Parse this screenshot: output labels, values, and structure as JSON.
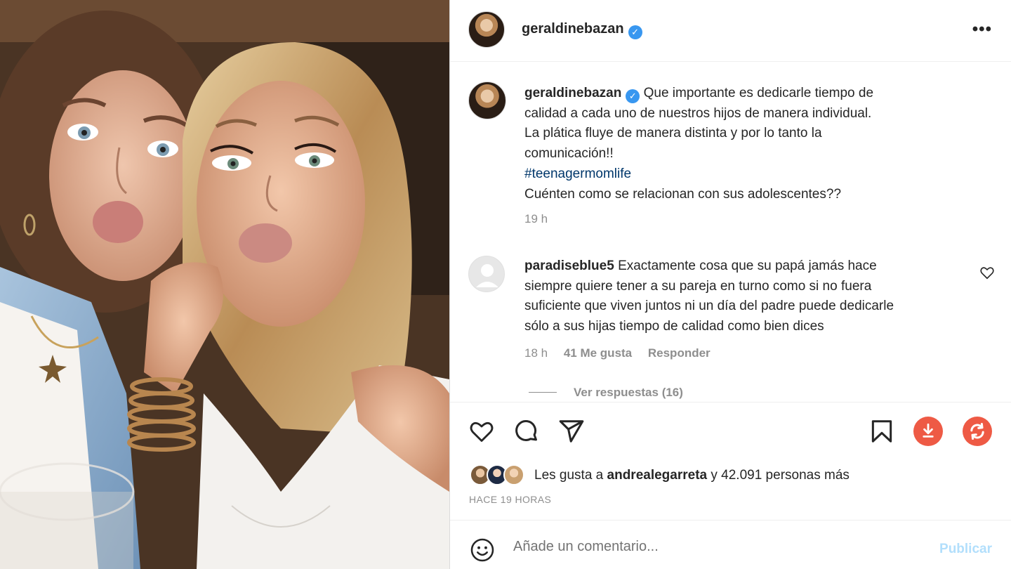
{
  "post": {
    "image_alt": "Selfie of two women making kiss faces",
    "author": {
      "username": "geraldinebazan",
      "verified": true
    },
    "caption": {
      "username": "geraldinebazan",
      "line1": "Que importante es dedicarle tiempo de",
      "line2": "calidad a cada uno de nuestros hijos de manera individual.",
      "line3": "La plática fluye de manera distinta y por lo tanto la",
      "line4": "comunicación!!",
      "hashtag": "#teenagermomlife",
      "line5": "Cuénten como se relacionan con sus adolescentes??",
      "time": "19 h"
    },
    "comments": [
      {
        "username": "paradiseblue5",
        "line1": "Exactamente cosa que su papá jamás hace",
        "line2": "siempre quiere tener a su pareja en turno como si no fuera",
        "line3": "suficiente que viven juntos ni un día del padre puede dedicarle",
        "line4": "sólo a sus hijas tiempo de calidad como bien dices",
        "time": "18 h",
        "likes": "41 Me gusta",
        "reply_label": "Responder",
        "view_replies": "Ver respuestas (16)"
      }
    ],
    "likes": {
      "prefix": "Les gusta a",
      "user": "andrealegarreta",
      "suffix": "y 42.091 personas más"
    },
    "posted": "HACE 19 HORAS"
  },
  "comment_box": {
    "placeholder": "Añade un comentario...",
    "publish_label": "Publicar"
  },
  "colors": {
    "verified": "#3897f0",
    "hashtag": "#00376b",
    "download_button": "#ee5a45",
    "refresh_button": "#ee5a45",
    "publish_disabled": "#b2dffc"
  },
  "icons": [
    "more-icon",
    "heart-icon",
    "comment-icon",
    "share-icon",
    "bookmark-icon",
    "download-icon",
    "refresh-icon",
    "emoji-icon"
  ]
}
